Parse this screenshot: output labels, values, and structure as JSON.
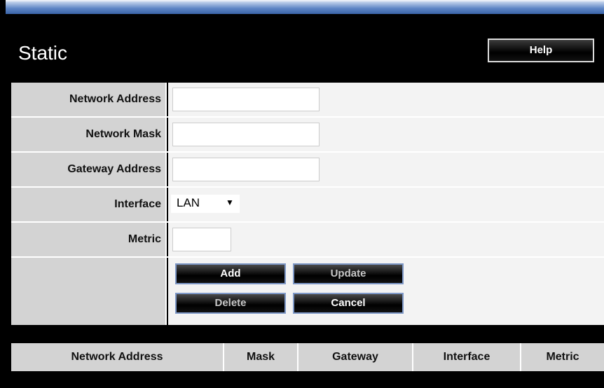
{
  "header": {
    "title": "Static",
    "help_label": "Help"
  },
  "form": {
    "network_address": {
      "label": "Network Address",
      "value": ""
    },
    "network_mask": {
      "label": "Network Mask",
      "value": ""
    },
    "gateway_address": {
      "label": "Gateway Address",
      "value": ""
    },
    "interface": {
      "label": "Interface",
      "value": "LAN"
    },
    "metric": {
      "label": "Metric",
      "value": ""
    }
  },
  "buttons": {
    "add": "Add",
    "update": "Update",
    "delete": "Delete",
    "cancel": "Cancel"
  },
  "table": {
    "columns": [
      "Network Address",
      "Mask",
      "Gateway",
      "Interface",
      "Metric"
    ]
  }
}
